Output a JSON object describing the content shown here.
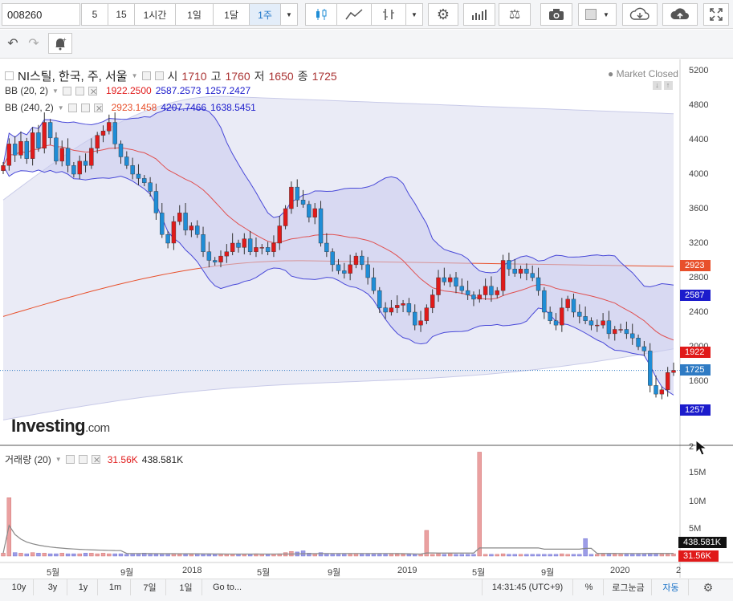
{
  "toolbar": {
    "symbol": "008260",
    "intervals": [
      "5",
      "15",
      "1시간",
      "1일",
      "1달",
      "1주"
    ],
    "active_interval": "1주"
  },
  "legend": {
    "name": "NI스틸, 한국, 주, 서울",
    "ohlc": [
      {
        "label": "시",
        "value": "1710"
      },
      {
        "label": "고",
        "value": "1760"
      },
      {
        "label": "저",
        "value": "1650"
      },
      {
        "label": "종",
        "value": "1725"
      }
    ],
    "market_status": "Market Closed",
    "bb20": {
      "label": "BB (20, 2)",
      "mid": "1922.2500",
      "upper": "2587.2573",
      "lower": "1257.2427"
    },
    "bb240": {
      "label": "BB (240, 2)",
      "mid": "2923.1458",
      "upper": "4207.7466",
      "lower": "1638.5451"
    },
    "volume": {
      "label": "거래량 (20)",
      "v1": "31.56K",
      "v2": "438.581K"
    }
  },
  "watermark": {
    "main": "Investing",
    "suffix": ".com"
  },
  "price_axis": {
    "ticks": [
      "5200",
      "4800",
      "4400",
      "4000",
      "3600",
      "3200",
      "2800",
      "2400",
      "2000",
      "1600"
    ],
    "partial_tick": "2",
    "tags": [
      {
        "text": "2923",
        "color": "#e8502b",
        "value": 2923
      },
      {
        "text": "2587",
        "color": "#1c1ccc",
        "value": 2587
      },
      {
        "text": "1922",
        "color": "#e01a1a",
        "value": 1922
      },
      {
        "text": "1725",
        "color": "#2f7bc4",
        "value": 1725
      },
      {
        "text": "1257",
        "color": "#1c1ccc",
        "value": 1257
      }
    ]
  },
  "volume_axis": {
    "ticks": [
      "15M",
      "10M",
      "5M"
    ],
    "tags": [
      {
        "text": "438.581K",
        "color": "#111111"
      },
      {
        "text": "31.56K",
        "color": "#e01a1a"
      }
    ]
  },
  "x_axis": [
    "5월",
    "9월",
    "2018",
    "5월",
    "9월",
    "2019",
    "5월",
    "9월",
    "2020",
    "2"
  ],
  "bottom": {
    "ranges": [
      "10y",
      "3y",
      "1y",
      "1m",
      "7일",
      "1일",
      "Go to..."
    ],
    "time": "14:31:45 (UTC+9)",
    "percent": "%",
    "log": "로그눈금",
    "auto": "자동"
  },
  "colors": {
    "up": "#e01a1a",
    "down": "#1f8dd6",
    "band": "#4848d8",
    "band_fill": "#d9dbef",
    "ma240": "#e8502b"
  },
  "chart_data": {
    "type": "candlestick",
    "x_unit": "week index from the first visible week (weekly bars, 2017-2020)",
    "ylim": [
      1300,
      5200
    ],
    "y_ticks": [
      1600,
      2000,
      2400,
      2800,
      3200,
      3600,
      4000,
      4400,
      4800,
      5200
    ],
    "closes": [
      4100,
      4350,
      4220,
      4380,
      4180,
      4480,
      4300,
      4600,
      4420,
      4150,
      4300,
      4100,
      4000,
      4150,
      4100,
      4300,
      4450,
      4500,
      4600,
      4350,
      4200,
      4100,
      4000,
      3950,
      3900,
      3800,
      3550,
      3300,
      3200,
      3450,
      3550,
      3350,
      3400,
      3300,
      3100,
      3000,
      2980,
      3050,
      3100,
      3200,
      3150,
      3250,
      3100,
      3150,
      3150,
      3100,
      3200,
      3400,
      3600,
      3850,
      3700,
      3650,
      3500,
      3600,
      3200,
      3100,
      2950,
      2880,
      2850,
      2950,
      3050,
      2950,
      2800,
      2650,
      2450,
      2400,
      2450,
      2480,
      2500,
      2400,
      2250,
      2300,
      2450,
      2600,
      2800,
      2750,
      2800,
      2700,
      2650,
      2600,
      2550,
      2600,
      2700,
      2600,
      2650,
      3000,
      2900,
      2850,
      2900,
      2850,
      2800,
      2650,
      2400,
      2300,
      2250,
      2450,
      2550,
      2400,
      2350,
      2300,
      2250,
      2250,
      2300,
      2150,
      2200,
      2200,
      2150,
      2100,
      2000,
      1950,
      1550,
      1450,
      1500,
      1700,
      1725
    ],
    "volumes_m": [
      0.5,
      0.7,
      0.6,
      0.5,
      0.4,
      0.6,
      0.5,
      0.5,
      0.4,
      0.4,
      0.5,
      0.4,
      0.4,
      0.4,
      0.5,
      0.5,
      0.4,
      0.5,
      0.4,
      0.4,
      0.4,
      0.3,
      0.4,
      0.4,
      0.5,
      0.4,
      0.3,
      0.4,
      0.4,
      0.4,
      0.3,
      0.3,
      0.3,
      0.4,
      0.3,
      0.3,
      0.3,
      0.3,
      0.3,
      0.3,
      0.3,
      0.3,
      0.3,
      0.4,
      0.3,
      0.3,
      0.3,
      0.4,
      0.6,
      0.8,
      0.7,
      0.9,
      0.5,
      0.4,
      0.6,
      0.4,
      0.3,
      0.3,
      0.3,
      0.3,
      0.4,
      0.3,
      0.3,
      0.3,
      0.3,
      0.3,
      0.3,
      0.3,
      0.3,
      0.3,
      0.3,
      0.3,
      0.3,
      0.3,
      0.4,
      0.3,
      0.4,
      0.3,
      0.3,
      0.3,
      0.3,
      0.3,
      0.3,
      0.3,
      0.3,
      0.4,
      0.3,
      0.3,
      0.3,
      0.3,
      0.3,
      0.3,
      0.3,
      0.3,
      0.3,
      0.4,
      0.3,
      0.3,
      0.3,
      0.3,
      0.3,
      0.3,
      0.3,
      0.3,
      0.3,
      0.3,
      0.3,
      0.3,
      0.3,
      0.3,
      0.4,
      0.4,
      0.3,
      0.3,
      0.4
    ],
    "volume_spikes": [
      {
        "index": 1,
        "volume_m": 10
      },
      {
        "index": 81,
        "volume_m": 17.8
      },
      {
        "index": 72,
        "volume_m": 4.4
      },
      {
        "index": 99,
        "volume_m": 3
      }
    ],
    "volume_ylim": [
      0,
      18
    ],
    "volume_ticks_m": [
      5,
      10,
      15
    ]
  }
}
